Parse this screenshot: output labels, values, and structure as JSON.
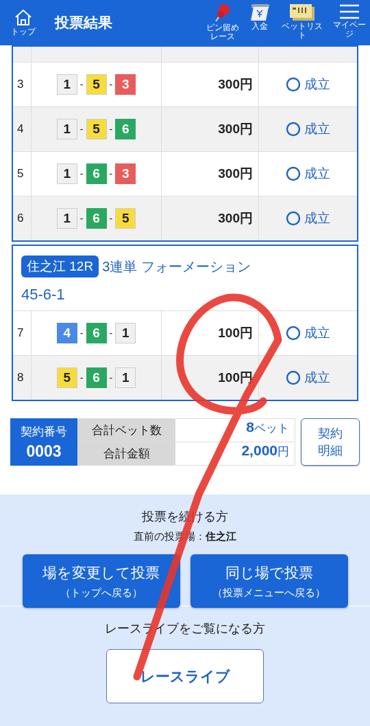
{
  "header": {
    "home": {
      "label": "トップ"
    },
    "title": "投票結果",
    "actions": [
      {
        "kind": "pin",
        "label": [
          "ピン留め",
          "レース"
        ]
      },
      {
        "kind": "deposit",
        "label": [
          "入金"
        ]
      },
      {
        "kind": "betlist",
        "label": [
          "ベットリスト"
        ]
      },
      {
        "kind": "menu",
        "label": [
          "マイページ"
        ]
      }
    ]
  },
  "bet_groups": [
    {
      "cut_row": true,
      "rows": [
        {
          "no": "3",
          "joiner": "-",
          "boats": [
            {
              "number": "1",
              "color": "#f0f0f0"
            },
            {
              "number": "5",
              "color": "#f7dc3c"
            },
            {
              "number": "3",
              "color": "#e85c5c"
            }
          ],
          "amount": "300円",
          "status": "成立"
        },
        {
          "no": "4",
          "joiner": "-",
          "boats": [
            {
              "number": "1",
              "color": "#f0f0f0"
            },
            {
              "number": "5",
              "color": "#f7dc3c"
            },
            {
              "number": "6",
              "color": "#2aa862"
            }
          ],
          "amount": "300円",
          "status": "成立"
        },
        {
          "no": "5",
          "joiner": "-",
          "boats": [
            {
              "number": "1",
              "color": "#f0f0f0"
            },
            {
              "number": "6",
              "color": "#2aa862"
            },
            {
              "number": "3",
              "color": "#e85c5c"
            }
          ],
          "amount": "300円",
          "status": "成立"
        },
        {
          "no": "6",
          "joiner": "-",
          "boats": [
            {
              "number": "1",
              "color": "#f0f0f0"
            },
            {
              "number": "6",
              "color": "#2aa862"
            },
            {
              "number": "5",
              "color": "#f7dc3c"
            }
          ],
          "amount": "300円",
          "status": "成立"
        }
      ]
    },
    {
      "cut_row": false,
      "venue": "住之江 12R",
      "bet_type": "3連単 フォーメーション",
      "combination": "45-6-1",
      "rows": [
        {
          "no": "7",
          "joiner": "-",
          "boats": [
            {
              "number": "4",
              "color": "#4a8ae6"
            },
            {
              "number": "6",
              "color": "#2aa862"
            },
            {
              "number": "1",
              "color": "#f0f0f0"
            }
          ],
          "amount": "100円",
          "status": "成立"
        },
        {
          "no": "8",
          "joiner": "-",
          "boats": [
            {
              "number": "5",
              "color": "#f7dc3c"
            },
            {
              "number": "6",
              "color": "#2aa862"
            },
            {
              "number": "1",
              "color": "#f0f0f0"
            }
          ],
          "amount": "100円",
          "status": "成立"
        }
      ]
    }
  ],
  "summary": {
    "contract_label": "契約番号",
    "contract_number": "0003",
    "stats": [
      {
        "label": "合計ベット数",
        "value": "8",
        "unit": "ベット"
      },
      {
        "label": "合計金額",
        "value": "2,000",
        "unit": "円"
      }
    ],
    "detail_button": [
      "契約",
      "明細"
    ]
  },
  "continue": {
    "heading": "投票を続ける方",
    "last_venue": "直前の投票場：**住之江**",
    "buttons": [
      {
        "label": "場を変更して投票",
        "sub": "（トップへ戻る）"
      },
      {
        "label": "同じ場で投票",
        "sub": "（投票メニューへ戻る）"
      }
    ]
  },
  "live": {
    "heading": "レースライブをご覧になる方",
    "button": "レースライブ"
  }
}
